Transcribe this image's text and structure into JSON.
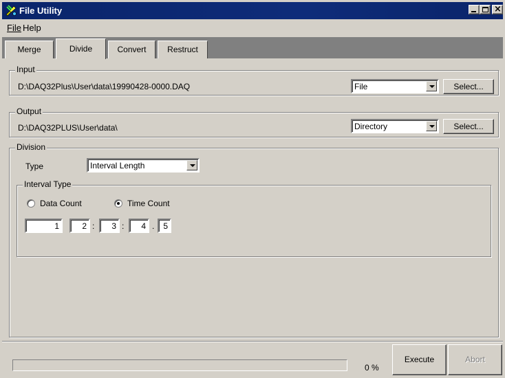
{
  "window": {
    "title": "File Utility",
    "icon": "file-utility-app-icon"
  },
  "menu": {
    "file": "File",
    "help": "Help"
  },
  "tabs": [
    {
      "label": "Merge",
      "active": false
    },
    {
      "label": "Divide",
      "active": true
    },
    {
      "label": "Convert",
      "active": false
    },
    {
      "label": "Restruct",
      "active": false
    }
  ],
  "input": {
    "legend": "Input",
    "path": "D:\\DAQ32Plus\\User\\data\\19990428-0000.DAQ",
    "mode": "File",
    "select_label": "Select..."
  },
  "output": {
    "legend": "Output",
    "path": "D:\\DAQ32PLUS\\User\\data\\",
    "mode": "Directory",
    "select_label": "Select..."
  },
  "division": {
    "legend": "Division",
    "type_label": "Type",
    "type_value": "Interval Length",
    "interval_type": {
      "legend": "Interval Type",
      "options": [
        {
          "label": "Data Count",
          "checked": false
        },
        {
          "label": "Time Count",
          "checked": true
        }
      ],
      "fields": [
        "1",
        "2",
        "3",
        "4",
        "5"
      ],
      "separators": [
        ":",
        ":",
        "."
      ]
    }
  },
  "footer": {
    "progress_fraction": 0,
    "progress_text": "0 %",
    "execute_label": "Execute",
    "abort_label": "Abort"
  },
  "colors": {
    "title_bar": "#0a246a",
    "face": "#d4d0c8",
    "tab_strip": "#808080"
  }
}
